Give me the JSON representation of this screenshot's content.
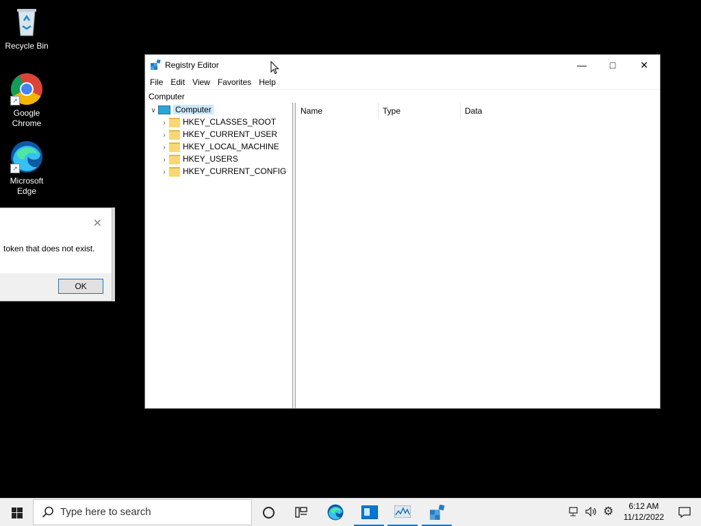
{
  "desktop": {
    "icons": [
      {
        "label": "Recycle Bin"
      },
      {
        "label": "Google Chrome"
      },
      {
        "label": "Microsoft Edge"
      }
    ]
  },
  "dialog": {
    "message": "token that does not exist.",
    "ok_label": "OK"
  },
  "window": {
    "title": "Registry Editor",
    "menu": [
      "File",
      "Edit",
      "View",
      "Favorites",
      "Help"
    ],
    "address": "Computer",
    "tree": {
      "root": "Computer",
      "children": [
        "HKEY_CLASSES_ROOT",
        "HKEY_CURRENT_USER",
        "HKEY_LOCAL_MACHINE",
        "HKEY_USERS",
        "HKEY_CURRENT_CONFIG"
      ]
    },
    "columns": [
      "Name",
      "Type",
      "Data"
    ]
  },
  "taskbar": {
    "search_placeholder": "Type here to search",
    "time": "6:12 AM",
    "date": "11/12/2022"
  },
  "colors": {
    "accent": "#0078d7",
    "selection": "#cce8ff",
    "folder": "#f8d775"
  }
}
